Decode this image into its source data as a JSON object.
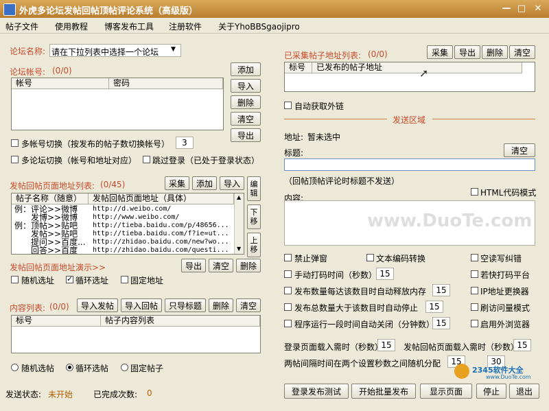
{
  "window": {
    "title": "外虎多论坛发帖回帖顶帖评论系统（高级版）",
    "min": "—",
    "max": "□",
    "close": "✕"
  },
  "menu": [
    "帖子文件",
    "使用教程",
    "博客发布工具",
    "注册软件",
    "关于YhoBBSgaojipro"
  ],
  "forum": {
    "label": "论坛名称:",
    "select_value": "请在下拉列表中选择一个论坛"
  },
  "accounts": {
    "label": "论坛帐号:",
    "count": "(0/0)",
    "headers": [
      "帐号",
      "密码"
    ],
    "buttons": [
      "添加",
      "导入",
      "删除",
      "清空",
      "导出"
    ]
  },
  "options1": {
    "multi_account": "多帐号切换（按发布的帖子数切换帐号）",
    "multi_account_value": "3",
    "multi_forum": "多论坛切换（帐号和地址对应）",
    "skip_login": "跳过登录（已处于登录状态）"
  },
  "reply_list": {
    "label": "发帖回帖页面地址列表:",
    "count": "(0/45)",
    "buttons": [
      "采集",
      "添加",
      "导入"
    ],
    "side_buttons": [
      "编辑",
      "下移",
      "上移"
    ],
    "headers": [
      "帖子名称（随意）",
      "发帖回帖页面地址（具体）"
    ],
    "rows": [
      {
        "name": "例：评论>>微博",
        "url": "http://d.weibo.com/"
      },
      {
        "name": "发博>>微博",
        "url": "http://www.weibo.com/"
      },
      {
        "name": "例：顶帖>>贴吧",
        "url": "http://tieba.baidu.com/p/48656..."
      },
      {
        "name": "发帖>>贴吧",
        "url": "http://tieba.baidu.com/f?ie=ut..."
      },
      {
        "name": "提问>>百度...",
        "url": "http://zhidao.baidu.com/new?wo..."
      },
      {
        "name": "回答>>百度",
        "url": "http://zhidao.baidu.com/questi..."
      }
    ],
    "demo_label": "发帖回帖页面地址演示>>",
    "bottom_buttons": [
      "导出",
      "清空",
      "删除"
    ],
    "random": "随机选址",
    "loop": "循环选址",
    "fixed": "固定地址"
  },
  "content_list": {
    "label": "内容列表:",
    "count": "(0/0)",
    "buttons": [
      "导入发帖",
      "导入回帖",
      "只导标题",
      "删除",
      "清空"
    ],
    "headers": [
      "标号",
      "帖子内容列表"
    ],
    "random": "随机选帖",
    "loop": "循环选帖",
    "fixed": "固定帖子"
  },
  "status": {
    "label": "发送状态:",
    "value": "未开始",
    "done_label": "已完成次数:",
    "done_value": "0"
  },
  "collected": {
    "label": "已采集帖子地址列表:",
    "count": "(0/0)",
    "buttons": [
      "采集",
      "导出",
      "删除",
      "清空"
    ],
    "headers": [
      "标号",
      "已发布的帖子地址"
    ],
    "auto_get": "自动获取外链"
  },
  "send": {
    "section": "发送区域",
    "address_label": "地址:",
    "address_value": "暂未选中",
    "title_label": "标题:",
    "clear": "清空",
    "title_note": "（回帖顶帖评论时标题不发送）",
    "content_label": "内容:",
    "html_mode": "HTML代码模式",
    "watermark": "www.DuoTe.com"
  },
  "opts": {
    "no_popup": "禁止弹窗",
    "text_encode": "文本编码转换",
    "space_fix": "空读写纠错",
    "manual_captcha": "手动打码时间（秒数）",
    "manual_captcha_value": "15",
    "fast_captcha": "若快打码平台",
    "release_mem": "发布数量每达该数目时自动释放内存",
    "release_mem_value": "15",
    "ip_change": "IP地址更换器",
    "auto_stop": "发布总数量大于该数目时自动停止",
    "auto_stop_value": "15",
    "refresh_mode": "刷访问量模式",
    "auto_close": "程序运行一段时间自动关闭（分钟数）",
    "auto_close_value": "15",
    "ext_browser": "启用外浏览器"
  },
  "timing": {
    "login_wait": "登录页面载入需时（秒数）",
    "login_wait_value": "15",
    "post_wait": "发帖回帖页面载入需时（秒数）",
    "post_wait_value": "15",
    "interval": "两帖间隔时间在两个设置秒数之间随机分配",
    "interval_min": "15",
    "interval_max": "30"
  },
  "bottom_buttons": [
    "登录发布测试",
    "开始批量发布",
    "显示页面",
    "停止",
    "退出"
  ],
  "badge": "2345软件大全",
  "badge_url": "www.DuoTe.com"
}
